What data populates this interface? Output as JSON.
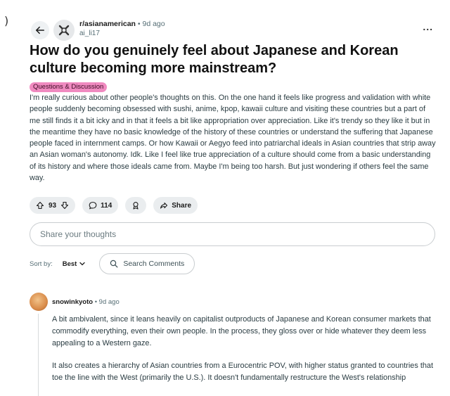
{
  "post": {
    "subreddit": "r/asianamerican",
    "time": "9d ago",
    "author": "ai_li17",
    "title": "How do you genuinely feel about Japanese and Korean culture becoming more mainstream?",
    "flair": "Questions & Discussion",
    "body": "I'm really curious about other people's thoughts on this. On the one hand it feels like progress and validation with white people suddenly becoming obsessed with sushi, anime, kpop, kawaii culture and visiting these countries but a part of me still finds it a bit icky and in that it feels a bit like appropriation over appreciation. Like it's trendy so they like it but in the meantime they have no basic knowledge of the history of these countries or understand the suffering that Japanese people faced in internment camps. Or how Kawaii or Aegyo feed into patriarchal ideals in Asian countries that strip away an Asian woman's autonomy. Idk. Like I feel like true appreciation of a culture should come from a basic understanding of its history and where those ideals came from. Maybe I'm being too harsh. But just wondering if others feel the same way.",
    "votes": "93",
    "comments": "114",
    "share_label": "Share",
    "more": "..."
  },
  "comment_box": {
    "placeholder": "Share your thoughts"
  },
  "sort": {
    "label": "Sort by:",
    "value": "Best",
    "search_label": "Search Comments"
  },
  "comment": {
    "author": "snowinkyoto",
    "time": "9d ago",
    "paragraphs": [
      "A bit ambivalent, since it leans heavily on capitalist outproducts of Japanese and Korean consumer markets that commodify everything, even their own people. In the process, they gloss over or hide whatever they deem less appealing to a Western gaze.",
      "It also creates a hierarchy of Asian countries from a Eurocentric POV, with higher status granted to countries that toe the line with the West (primarily the U.S.). It doesn't fundamentally restructure the West's relationship"
    ]
  },
  "icons": [
    "back-arrow-icon",
    "subreddit-icon",
    "upvote-icon",
    "downvote-icon",
    "comment-icon",
    "award-icon",
    "share-icon",
    "chevron-down-icon",
    "search-icon"
  ],
  "colors": {
    "flair_bg": "#f08ac0",
    "pill_bg": "#eaedef",
    "text": "#1c1c1c",
    "muted": "#576f76"
  }
}
